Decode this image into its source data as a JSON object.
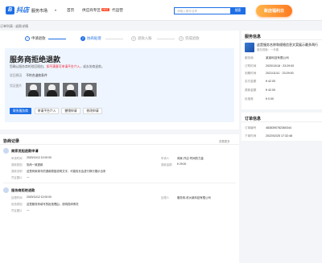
{
  "header": {
    "logo_mark": "B",
    "logo_text": "抖店",
    "site_name": "服务市场",
    "nav": [
      "首页",
      "供应商专区",
      "代运营"
    ],
    "hot_badge": "HOT",
    "search_placeholder": "请输入服务名称",
    "search_button": "搜索",
    "promo": "新店福利日"
  },
  "breadcrumb": [
    "订单列表",
    "退款详情"
  ],
  "steps": [
    {
      "num": "✓",
      "label": "申请退款"
    },
    {
      "num": "2",
      "label": "协商处理"
    },
    {
      "num": "3",
      "label": "退款入账"
    },
    {
      "num": "4",
      "label": "完成退款"
    }
  ],
  "status": {
    "title": "服务商拒绝退款",
    "desc_prefix": "您确认服务商的驳回理由，",
    "desc_highlight": "如不满意可申请平台介入",
    "desc_suffix": "，或去协商退款。",
    "reason_label": "驳回原因",
    "reason_value": "不符合退款条件",
    "evidence_label": "凭证图片",
    "btn_primary": "联系服务商",
    "btn_secondary_1": "申请平台介入",
    "btn_secondary_2": "撤销申请",
    "btn_secondary_3": "修改申请"
  },
  "service_card": {
    "title": "服务信息",
    "name": "这是服务名称和规格信息文案展示最多两行",
    "spec": "服务规格：一年期",
    "rows": [
      {
        "k": "服务商",
        "v": "某某科技有限公司"
      },
      {
        "k": "订购时间",
        "v": "2020/10/18 · 23:29:00"
      },
      {
        "k": "到期时间",
        "v": "2021/11/11 · 23:29:00"
      },
      {
        "k": "实付金额",
        "v": "¥ 42.00"
      },
      {
        "k": "退款金额",
        "v": "¥ 42.00"
      },
      {
        "k": "优惠券",
        "v": "¥ 0.00"
      }
    ]
  },
  "order_card": {
    "title": "订单信息",
    "rows": [
      {
        "k": "订单编号",
        "v": "4838390782360344"
      },
      {
        "k": "下单时间",
        "v": "2022/02/25 17:32:48"
      }
    ]
  },
  "record": {
    "title": "协商记录",
    "hint": "查看更多",
    "entries": [
      {
        "title": "商家发起退款申请",
        "rows": [
          {
            "k": "申请时间",
            "v": "2020/11/12 12:00:00",
            "k2": "申请人",
            "v2": "商家-开店·时间的力量"
          },
          {
            "k": "退款原因",
            "v": "协商一致退款",
            "k2": "退款金额",
            "v2": "¥ 29.00"
          },
          {
            "k": "退款说明",
            "v": "这是商家填写的退款原因说明文字，可能较长会进行换行展示出来"
          },
          {
            "k": "凭证图片",
            "v": "—"
          }
        ]
      },
      {
        "title": "服务商拒绝退款",
        "rows": [
          {
            "k": "处理时间",
            "v": "2020/11/12 12:00:00",
            "k2": "处理人",
            "v2": "服务商-杭州某科技有限公司"
          },
          {
            "k": "拒绝原因",
            "v": "这是服务商填写的拒绝理由，说明具体情况"
          },
          {
            "k": "凭证图片",
            "v": "—"
          }
        ]
      }
    ]
  }
}
